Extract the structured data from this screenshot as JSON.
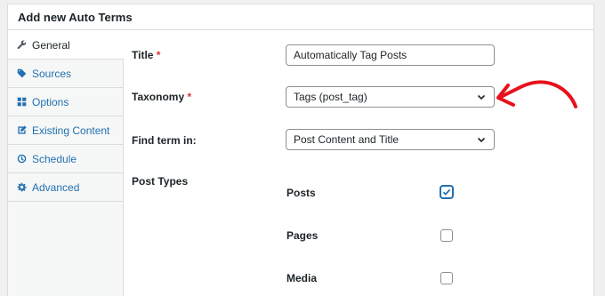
{
  "panel": {
    "title": "Add new Auto Terms"
  },
  "sidebar": {
    "items": [
      {
        "label": "General",
        "icon": "wrench-icon"
      },
      {
        "label": "Sources",
        "icon": "tag-icon"
      },
      {
        "label": "Options",
        "icon": "grid-icon"
      },
      {
        "label": "Existing Content",
        "icon": "edit-icon"
      },
      {
        "label": "Schedule",
        "icon": "clock-icon"
      },
      {
        "label": "Advanced",
        "icon": "gear-icon"
      }
    ]
  },
  "form": {
    "title": {
      "label": "Title",
      "required": "*",
      "value": "Automatically Tag Posts"
    },
    "taxonomy": {
      "label": "Taxonomy",
      "required": "*",
      "value": "Tags (post_tag)"
    },
    "find_term": {
      "label": "Find term in:",
      "value": "Post Content and Title"
    },
    "post_types": {
      "label": "Post Types",
      "items": [
        {
          "label": "Posts",
          "checked": true
        },
        {
          "label": "Pages",
          "checked": false
        },
        {
          "label": "Media",
          "checked": false
        }
      ]
    }
  },
  "colors": {
    "accent": "#2271b1",
    "annotation_arrow": "#e8101c",
    "required": "#d63638"
  }
}
